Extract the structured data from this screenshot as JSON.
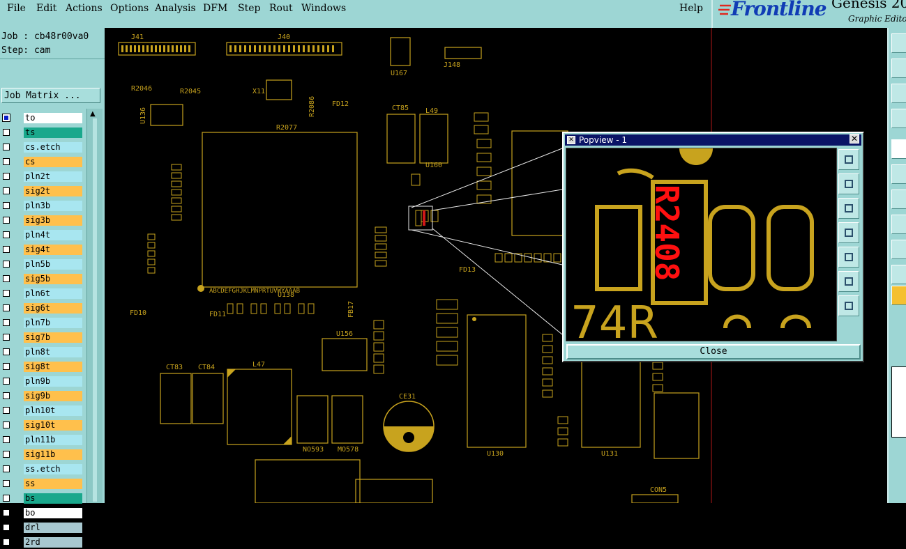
{
  "menu": {
    "items": [
      "File",
      "Edit",
      "Actions",
      "Options",
      "Analysis",
      "DFM",
      "Step",
      "Rout",
      "Windows"
    ],
    "help": "Help"
  },
  "brand": {
    "logo": "Frontline",
    "product": "Genesis 20",
    "subtitle": "Graphic Editor"
  },
  "job": {
    "job_line": "Job : cb48r00va0",
    "step_line": "Step: cam",
    "matrix_button": "Job Matrix ..."
  },
  "layers": [
    {
      "name": "to",
      "color": "#ffffff",
      "selected": true
    },
    {
      "name": "ts",
      "color": "#1aa88c",
      "selected": false
    },
    {
      "name": "cs.etch",
      "color": "#a8e6f0",
      "selected": false
    },
    {
      "name": "cs",
      "color": "#ffc04c",
      "selected": false
    },
    {
      "name": "pln2t",
      "color": "#a8e6f0",
      "selected": false
    },
    {
      "name": "sig2t",
      "color": "#ffc04c",
      "selected": false
    },
    {
      "name": "pln3b",
      "color": "#a8e6f0",
      "selected": false
    },
    {
      "name": "sig3b",
      "color": "#ffc04c",
      "selected": false
    },
    {
      "name": "pln4t",
      "color": "#a8e6f0",
      "selected": false
    },
    {
      "name": "sig4t",
      "color": "#ffc04c",
      "selected": false
    },
    {
      "name": "pln5b",
      "color": "#a8e6f0",
      "selected": false
    },
    {
      "name": "sig5b",
      "color": "#ffc04c",
      "selected": false
    },
    {
      "name": "pln6t",
      "color": "#a8e6f0",
      "selected": false
    },
    {
      "name": "sig6t",
      "color": "#ffc04c",
      "selected": false
    },
    {
      "name": "pln7b",
      "color": "#a8e6f0",
      "selected": false
    },
    {
      "name": "sig7b",
      "color": "#ffc04c",
      "selected": false
    },
    {
      "name": "pln8t",
      "color": "#a8e6f0",
      "selected": false
    },
    {
      "name": "sig8t",
      "color": "#ffc04c",
      "selected": false
    },
    {
      "name": "pln9b",
      "color": "#a8e6f0",
      "selected": false
    },
    {
      "name": "sig9b",
      "color": "#ffc04c",
      "selected": false
    },
    {
      "name": "pln10t",
      "color": "#a8e6f0",
      "selected": false
    },
    {
      "name": "sig10t",
      "color": "#ffc04c",
      "selected": false
    },
    {
      "name": "pln11b",
      "color": "#a8e6f0",
      "selected": false
    },
    {
      "name": "sig11b",
      "color": "#ffc04c",
      "selected": false
    },
    {
      "name": "ss.etch",
      "color": "#a8e6f0",
      "selected": false
    },
    {
      "name": "ss",
      "color": "#ffc04c",
      "selected": false
    },
    {
      "name": "bs",
      "color": "#1aa88c",
      "selected": false
    },
    {
      "name": "bo",
      "color": "#ffffff",
      "selected": false
    },
    {
      "name": "drl",
      "color": "#a8c8d0",
      "selected": false
    },
    {
      "name": "2rd",
      "color": "#a8c8d0",
      "selected": false
    }
  ],
  "canvas": {
    "trace_color": "#c8a31e",
    "labels": [
      "J41",
      "J40",
      "J148",
      "U167",
      "X11",
      "U136",
      "U138",
      "CT83",
      "CT84",
      "L47",
      "U156",
      "CE31",
      "U130",
      "U131",
      "L49",
      "U160",
      "CT85",
      "NO593",
      "MO578",
      "R2077",
      "R2045",
      "R2046",
      "R2086",
      "FD12",
      "FD10",
      "FD11",
      "FB17",
      "FD13",
      "CON5"
    ],
    "pin_row": "ABCDEFGHJKLMNPRTUVWYAAAB"
  },
  "popview": {
    "title": "Popview - 1",
    "designator": "R2408",
    "label_bottom": "74R",
    "close_label": "Close"
  }
}
